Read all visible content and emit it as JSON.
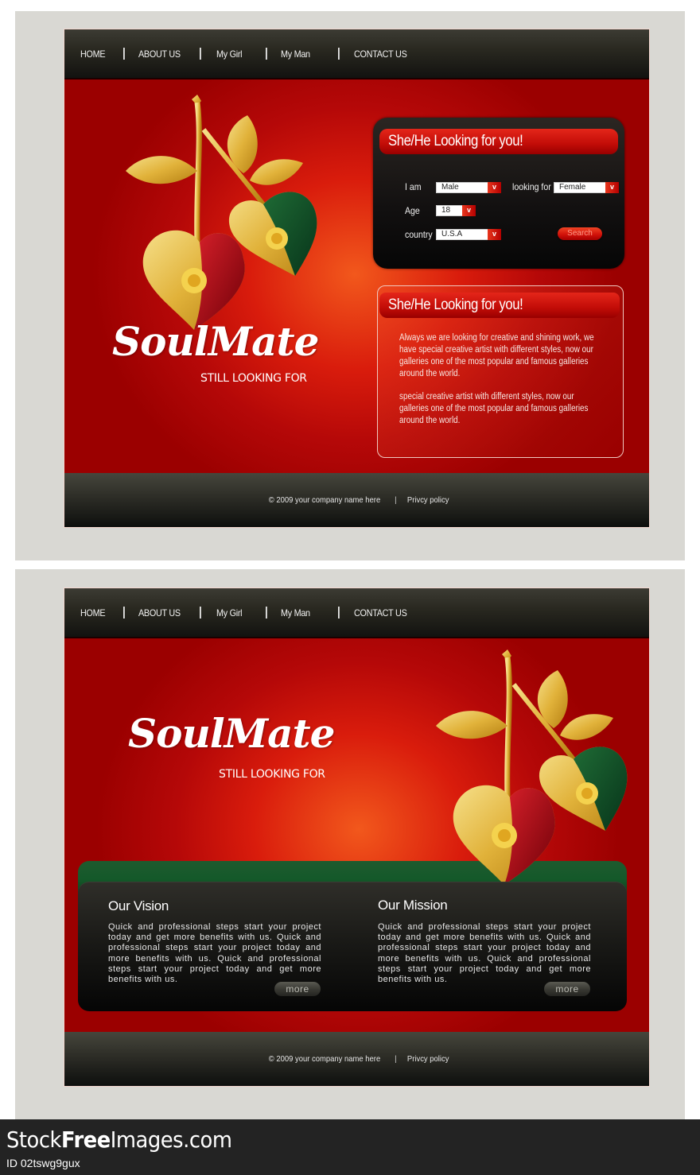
{
  "nav": {
    "items": [
      "HOME",
      "ABOUT US",
      "My Girl",
      "My Man",
      "CONTACT US"
    ]
  },
  "brand": {
    "name": "SoulMate",
    "tagline": "STILL LOOKING FOR",
    "illustration": "golden-heart-cherries-illustration"
  },
  "search_form": {
    "title": "She/He Looking for you!",
    "i_am_label": "I am",
    "i_am_value": "Male",
    "looking_for_label": "looking for",
    "looking_for_value": "Female",
    "age_label": "Age",
    "age_value": "18",
    "country_label": "country",
    "country_value": "U.S.A",
    "search_button": "Search",
    "dropdown_icon": "chevron-down-icon"
  },
  "info_box": {
    "title": "She/He Looking for you!",
    "paragraphs": [
      "Always we are looking for creative and shining work, we have special creative artist with different styles, now our galleries one of the most popular and famous galleries around the world.",
      "special creative artist with different styles, now our galleries one of the most popular and famous galleries around the world."
    ]
  },
  "sections": [
    {
      "title": "Our Vision",
      "text": "Quick and professional steps start your project today and get more benefits with us. Quick and professional steps start your project today and more benefits with us. Quick and professional steps start your project today and get more benefits with us.",
      "button": "more"
    },
    {
      "title": "Our Mission",
      "text": "Quick and professional steps start your project today and get more benefits with us. Quick and professional steps start your project today and more benefits with us. Quick and professional steps start your project today and get more benefits with us.",
      "button": "more"
    }
  ],
  "footer": {
    "copyright": "© 2009 your company name here",
    "separator": "|",
    "privacy": "Privcy policy"
  },
  "watermark": {
    "brand_prefix": "Stock",
    "brand_bold": "Free",
    "brand_suffix": "Images.com",
    "id": "ID 02tswg9gux"
  },
  "colors": {
    "accent_red": "#c20c07",
    "dark": "#121010",
    "green": "#14592a",
    "gold": "#e3b93f",
    "panel_bg": "#d9d8d3"
  }
}
